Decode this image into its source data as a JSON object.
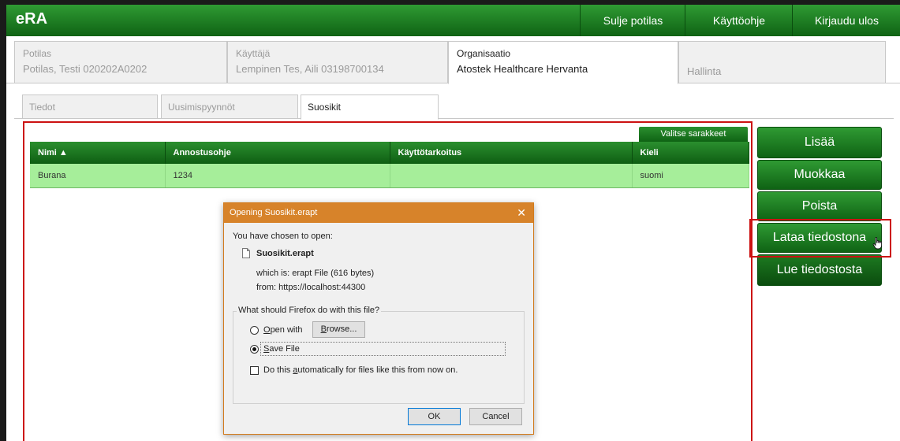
{
  "app": {
    "logo": "eRA",
    "nav": [
      "Sulje potilas",
      "Käyttöohje",
      "Kirjaudu ulos"
    ]
  },
  "context_tabs": [
    {
      "label": "Potilas",
      "value": "Potilas, Testi 020202A0202"
    },
    {
      "label": "Käyttäjä",
      "value": "Lempinen Tes, Aili 03198700134"
    },
    {
      "label": "Organisaatio",
      "value": "Atostek Healthcare Hervanta"
    },
    {
      "label": "",
      "value": "Hallinta"
    }
  ],
  "sub_tabs": [
    "Tiedot",
    "Uusimispyynnöt",
    "Suosikit"
  ],
  "table": {
    "select_columns": "Valitse sarakkeet",
    "headers": [
      "Nimi ▲",
      "Annostusohje",
      "Käyttötarkoitus",
      "Kieli"
    ],
    "rows": [
      [
        "Burana",
        "1234",
        "",
        "suomi"
      ]
    ]
  },
  "side_buttons": [
    "Lisää",
    "Muokkaa",
    "Poista",
    "Lataa tiedostona",
    "Lue tiedostosta"
  ],
  "dialog": {
    "title": "Opening Suosikit.erapt",
    "close": "✕",
    "intro": "You have chosen to open:",
    "filename": "Suosikit.erapt",
    "which_is": "which is: erapt File (616 bytes)",
    "from": "from: https://localhost:44300",
    "question": "What should Firefox do with this file?",
    "open_with_label": "Open with",
    "browse": "Browse...",
    "save_file": "Save File",
    "auto_label": "Do this automatically for files like this from now on.",
    "ok": "OK",
    "cancel": "Cancel",
    "selected_option": "Save File"
  },
  "colors": {
    "brand_green": "#1f7d23",
    "row_green": "#a6ee9a",
    "dialog_orange": "#d7832a",
    "highlight_red": "#cc1111"
  }
}
